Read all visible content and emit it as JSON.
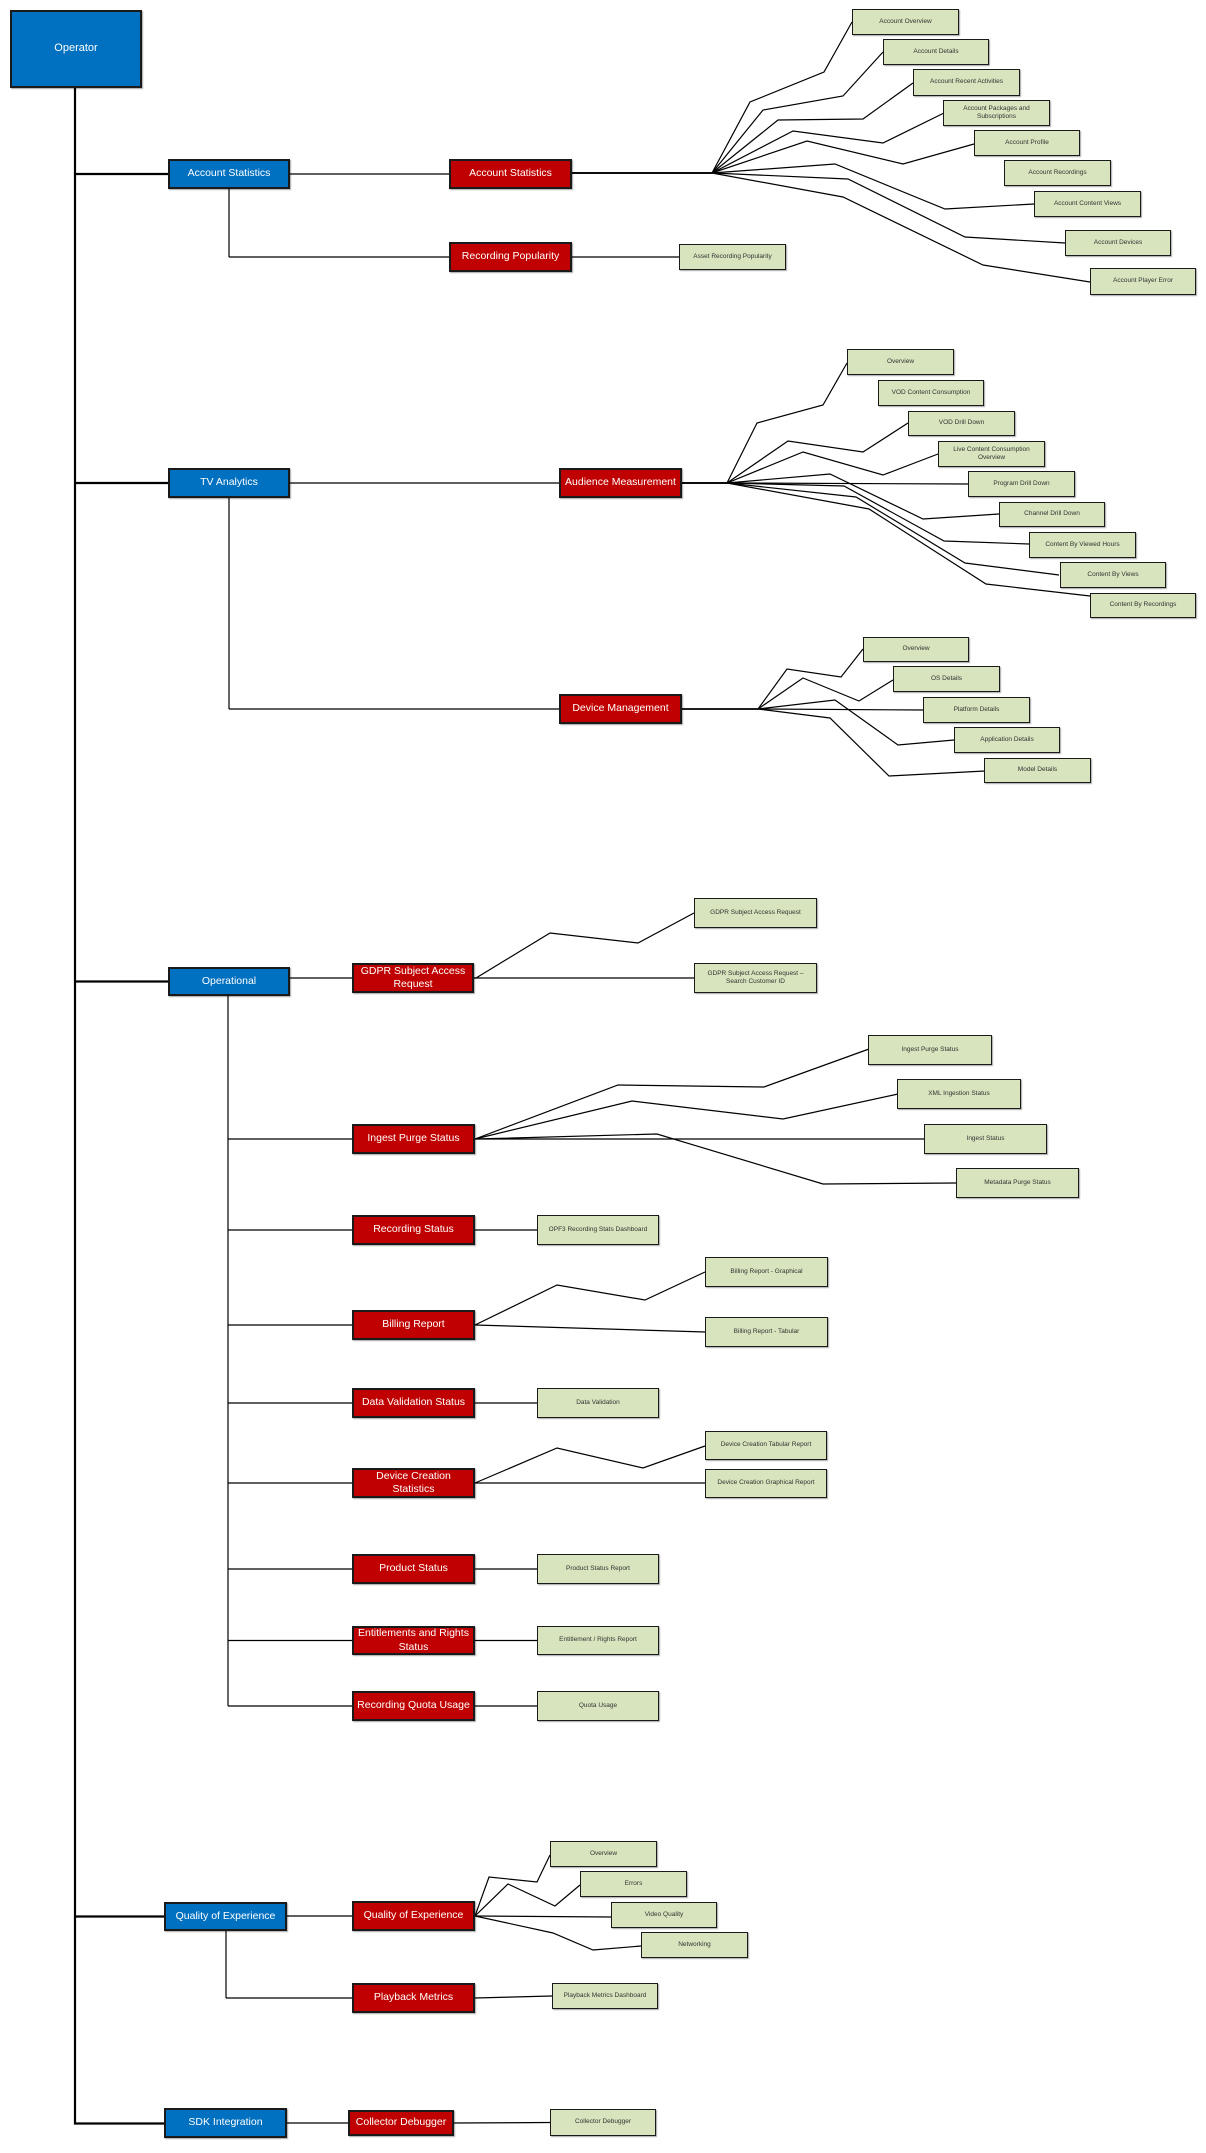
{
  "diagram": {
    "title": "Operator",
    "colors": {
      "category": "#0070C0",
      "report_group": "#C00000",
      "dashboard": "#D7E4BD",
      "connector": "#000000"
    },
    "sections": [
      {
        "id": "account",
        "label": "Account Statistics",
        "groups": [
          {
            "id": "acct-stats",
            "label": "Account Statistics",
            "dashboards": [
              "Account Overview",
              "Account Details",
              "Account Recent Activities",
              "Account Packages and Subscriptions",
              "Account Profile",
              "Account Recordings",
              "Account Content Views",
              "Account Devices",
              "Account Player Error"
            ]
          },
          {
            "id": "rec-pop",
            "label": "Recording Popularity",
            "dashboards": [
              "Asset Recording Popularity"
            ]
          }
        ]
      },
      {
        "id": "tv",
        "label": "TV Analytics",
        "groups": [
          {
            "id": "aud",
            "label": "Audience Measurement",
            "dashboards": [
              "Overview",
              "VOD Content Consumption",
              "VOD Drill Down",
              "Live Content Consumption Overview",
              "Program Drill Down",
              "Channel Drill Down",
              "Content By Viewed Hours",
              "Content By Views",
              "Content By Recordings"
            ]
          },
          {
            "id": "devmgmt",
            "label": "Device Management",
            "dashboards": [
              "Overview",
              "OS Details",
              "Platform Details",
              "Application Details",
              "Model Details"
            ]
          }
        ]
      },
      {
        "id": "ops",
        "label": "Operational",
        "groups": [
          {
            "id": "gdpr",
            "label": "GDPR Subject Access Request",
            "dashboards": [
              "GDPR Subject Access Request",
              "GDPR Subject Access Request – Search Customer ID"
            ]
          },
          {
            "id": "ingest",
            "label": "Ingest Purge Status",
            "dashboards": [
              "Ingest Purge Status",
              "XML Ingestion Status",
              "Ingest Status",
              "Metadata Purge Status"
            ]
          },
          {
            "id": "recstat",
            "label": "Recording Status",
            "dashboards": [
              "OPF3 Recording Stats Dashboard"
            ]
          },
          {
            "id": "billing",
            "label": "Billing Report",
            "dashboards": [
              "Billing Report - Graphical",
              "Billing Report - Tabular"
            ]
          },
          {
            "id": "dataval",
            "label": "Data Validation Status",
            "dashboards": [
              "Data Validation"
            ]
          },
          {
            "id": "devcre",
            "label": "Device Creation Statistics",
            "dashboards": [
              "Device Creation Tabular Report",
              "Device Creation Graphical Report"
            ]
          },
          {
            "id": "prod",
            "label": "Product Status",
            "dashboards": [
              "Product Status Report"
            ]
          },
          {
            "id": "ent",
            "label": "Entitlements and Rights Status",
            "dashboards": [
              "Entitlement / Rights Report"
            ]
          },
          {
            "id": "quota",
            "label": "Recording Quota Usage",
            "dashboards": [
              "Quota Usage"
            ]
          }
        ]
      },
      {
        "id": "qoe",
        "label": "Quality of Experience",
        "groups": [
          {
            "id": "qoe2",
            "label": "Quality of Experience",
            "dashboards": [
              "Overview",
              "Errors",
              "Video Quality",
              "Networking"
            ]
          },
          {
            "id": "playback",
            "label": "Playback Metrics",
            "dashboards": [
              "Playback Metrics Dashboard"
            ]
          }
        ]
      },
      {
        "id": "sdk",
        "label": "SDK Integration",
        "groups": [
          {
            "id": "collector",
            "label": "Collector Debugger",
            "dashboards": [
              "Collector Debugger"
            ]
          }
        ]
      }
    ]
  }
}
